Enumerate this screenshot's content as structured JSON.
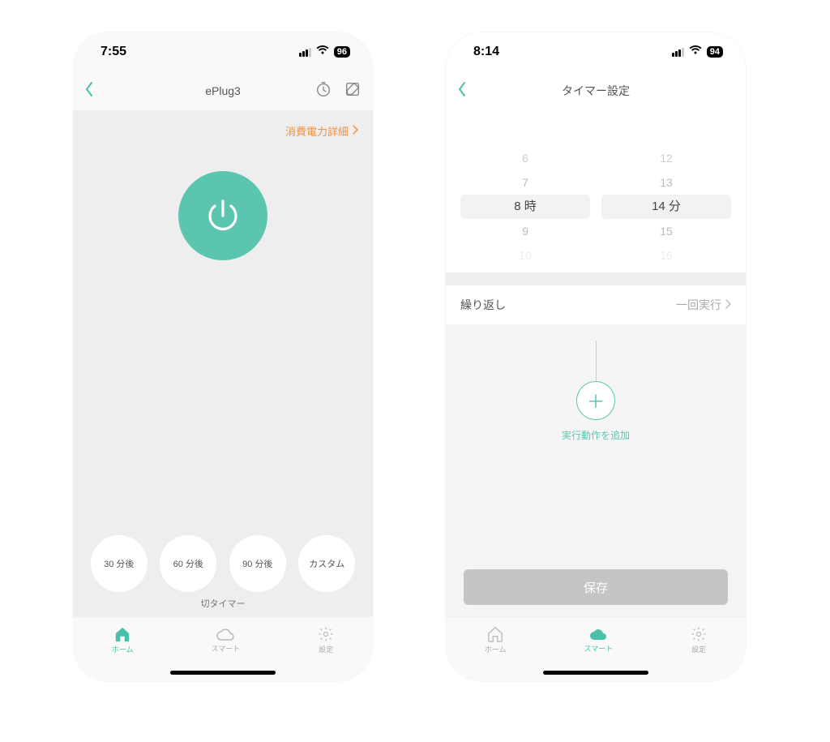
{
  "colors": {
    "accent": "#5cc5b0",
    "orange": "#f0913e"
  },
  "left": {
    "status": {
      "time": "7:55",
      "battery": "96"
    },
    "nav": {
      "title": "ePlug3"
    },
    "power_detail": "消費電力詳細",
    "timers": [
      "30 分後",
      "60 分後",
      "90 分後",
      "カスタム"
    ],
    "timer_section_label": "切タイマー",
    "tabs": {
      "home": "ホーム",
      "smart": "スマート",
      "settings": "設定"
    }
  },
  "right": {
    "status": {
      "time": "8:14",
      "battery": "94"
    },
    "nav": {
      "title": "タイマー設定"
    },
    "picker": {
      "hour": {
        "above2": "",
        "above1": "6",
        "above0": "7",
        "sel": "8 時",
        "below0": "9",
        "below1": "10"
      },
      "min": {
        "above2": "",
        "above1": "12",
        "above0": "13",
        "sel": "14 分",
        "below0": "15",
        "below1": "16"
      }
    },
    "repeat": {
      "label": "繰り返し",
      "value": "一回実行"
    },
    "add_label": "実行動作を追加",
    "save": "保存",
    "tabs": {
      "home": "ホーム",
      "smart": "スマート",
      "settings": "設定"
    }
  }
}
